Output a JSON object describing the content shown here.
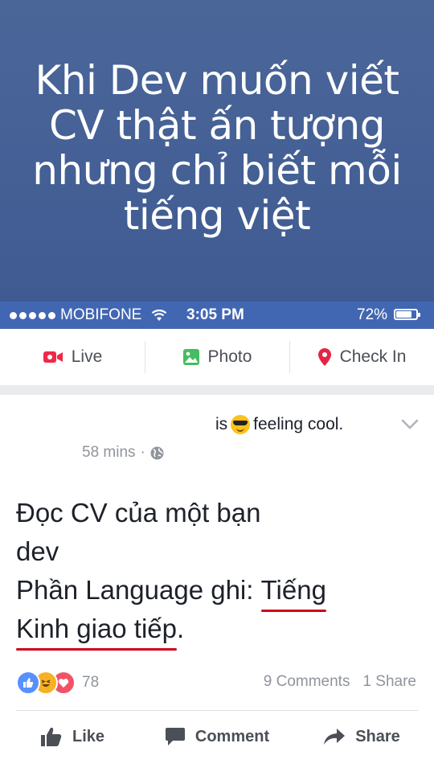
{
  "banner": {
    "line1": "Khi Dev muốn viết",
    "line2": "CV thật ấn tượng",
    "line3": "nhưng chỉ biết mỗi",
    "line4": "tiếng việt"
  },
  "status_bar": {
    "carrier": "MOBIFONE",
    "time": "3:05 PM",
    "battery": "72%",
    "battery_level": 0.72
  },
  "composer_actions": [
    {
      "label": "Live",
      "icon": "video-camera-icon",
      "color": "#f02849"
    },
    {
      "label": "Photo",
      "icon": "photo-icon",
      "color": "#45bd62"
    },
    {
      "label": "Check In",
      "icon": "location-pin-icon",
      "color": "#e42645"
    }
  ],
  "post": {
    "feeling_prefix": "is",
    "feeling_emoji": "sunglasses-emoji",
    "feeling_text": "feeling cool.",
    "timestamp": "58 mins",
    "separator": "·",
    "privacy_icon": "globe-icon",
    "body": {
      "line1": "Đọc CV của một bạn",
      "line2": "dev",
      "line3_prefix": "Phần Language ghi: ",
      "line3_underlined": "Tiếng",
      "line4_underlined": "Kinh giao tiếp",
      "line4_suffix": "."
    },
    "reactions": [
      "like",
      "haha",
      "love"
    ],
    "reaction_count": "78",
    "comments": "9 Comments",
    "shares": "1 Share",
    "underline_color": "#d0021b"
  },
  "post_actions": [
    {
      "label": "Like",
      "icon": "thumbs-up-icon"
    },
    {
      "label": "Comment",
      "icon": "comment-bubble-icon"
    },
    {
      "label": "Share",
      "icon": "share-arrow-icon"
    }
  ]
}
